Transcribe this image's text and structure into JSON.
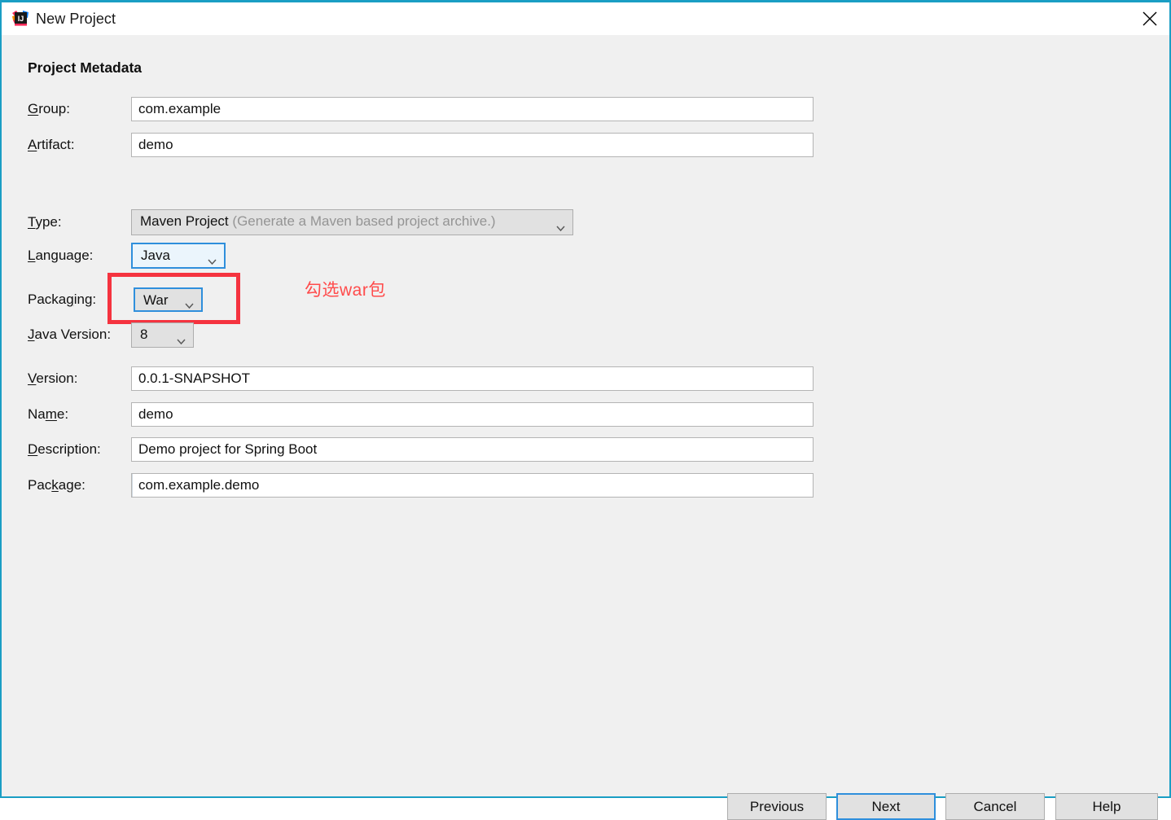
{
  "window": {
    "title": "New Project",
    "app_icon": "intellij-idea-icon",
    "close_icon": "close-icon",
    "border_color": "#1a9ec4"
  },
  "form": {
    "section_title": "Project Metadata",
    "fields": {
      "group": {
        "label": "Group:",
        "mnemonic": "G",
        "value": "com.example"
      },
      "artifact": {
        "label": "Artifact:",
        "mnemonic": "A",
        "value": "demo"
      },
      "type": {
        "label": "Type:",
        "mnemonic": "T",
        "value": "Maven Project",
        "hint": "(Generate a Maven based project archive.)"
      },
      "language": {
        "label": "Language:",
        "mnemonic": "L",
        "value": "Java"
      },
      "packaging": {
        "label": "Packaging:",
        "mnemonic": "g",
        "value": "War"
      },
      "java_version": {
        "label": "Java Version:",
        "mnemonic": "J",
        "value": "8"
      },
      "version": {
        "label": "Version:",
        "mnemonic": "V",
        "value": "0.0.1-SNAPSHOT"
      },
      "name": {
        "label": "Name:",
        "mnemonic": "m",
        "value": "demo"
      },
      "description": {
        "label": "Description:",
        "mnemonic": "D",
        "value": "Demo project for Spring Boot"
      },
      "package": {
        "label": "Package:",
        "mnemonic": "k",
        "value": "com.example.demo"
      }
    }
  },
  "annotation": {
    "note": "勾选war包",
    "color": "#ff4b4b",
    "rect_color": "#f5333f"
  },
  "buttons": {
    "previous": "Previous",
    "next": "Next",
    "cancel": "Cancel",
    "help": "Help",
    "default_button": "Next",
    "focus_color": "#2f8fdc"
  }
}
